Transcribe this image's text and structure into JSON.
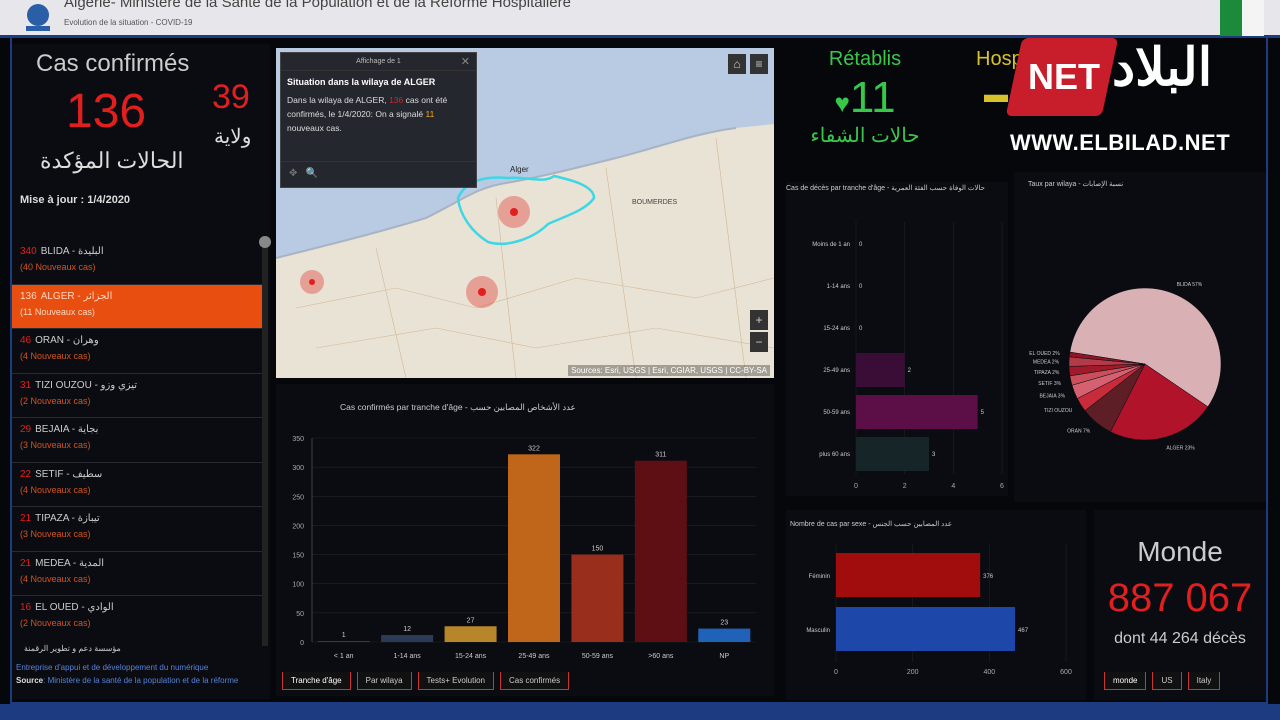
{
  "header": {
    "title": "Algérie- Ministère de la Santé de la Population et de la Réforme Hospitalière",
    "subtitle": "Evolution de la situation - COVID-19"
  },
  "left": {
    "cas_title": "Cas confirmés",
    "cas_value": "136",
    "cas_ar": "الحالات المؤكدة",
    "wilaya_value": "39",
    "wilaya_ar": "ولاية",
    "maj": "Mise à jour : 1/4/2020",
    "items": [
      {
        "n": "340",
        "name": "BLIDA - البليدة",
        "sub": "(40 Nouveaux cas)"
      },
      {
        "n": "136",
        "name": "ALGER - الجزائر",
        "sub": "(11 Nouveaux cas)"
      },
      {
        "n": "46",
        "name": "ORAN - وهران",
        "sub": "(4 Nouveaux cas)"
      },
      {
        "n": "31",
        "name": "TIZI OUZOU - تيزي وزو",
        "sub": "(2 Nouveaux cas)"
      },
      {
        "n": "29",
        "name": "BEJAIA - بجاية",
        "sub": "(3 Nouveaux cas)"
      },
      {
        "n": "22",
        "name": "SETIF - سطيف",
        "sub": "(4 Nouveaux cas)"
      },
      {
        "n": "21",
        "name": "TIPAZA - تيبازة",
        "sub": "(3 Nouveaux cas)"
      },
      {
        "n": "21",
        "name": "MEDEA - المدية",
        "sub": "(4 Nouveaux cas)"
      },
      {
        "n": "16",
        "name": "EL OUED - الوادي",
        "sub": "(2 Nouveaux cas)"
      }
    ],
    "footer_ar": "مؤسسة دعم و تطوير الرقمنة",
    "footer_org": "Entreprise d'appui et de développement du numérique",
    "footer_source_label": "Source",
    "footer_source": ": Ministère de la santé de la population et de la réforme"
  },
  "map": {
    "popup_header": "Affichage de 1",
    "popup_title": "Situation dans la wilaya de ALGER",
    "popup_text_a": "Dans la wilaya de ALGER,",
    "popup_red": "136",
    "popup_text_b": "cas ont été confirmés, le 1/4/2020: On a signalé",
    "popup_yellow": "11",
    "popup_text_c": "nouveaux cas.",
    "label_alger": "Alger",
    "label_boumerdes": "BOUMERDES",
    "attribution": "Sources: Esri, USGS | Esri, CGIAR, USGS | CC-BY-SA",
    "zoom_in": "+",
    "zoom_out": "−",
    "colors": {
      "sea": "#b9cbe2",
      "land": "#e9e3d5",
      "boundary": "#3fd6e6",
      "hotspot": "#e21f1f"
    }
  },
  "stats": {
    "retablis_label": "Rétablis",
    "retablis_value": "11",
    "retablis_ar": "حالات الشفاء",
    "hosp_label": "Hosp",
    "hosp_value": "..."
  },
  "watermark": {
    "net": "NET",
    "ar": "البلاد",
    "url": "WWW.ELBILAD.NET"
  },
  "monde": {
    "label": "Monde",
    "value": "887 067",
    "deaths": "dont 44 264 décès"
  },
  "tabs_bottom": [
    "Tranche d'âge",
    "Par wilaya",
    "Tests+ Evolution",
    "Cas confirmés"
  ],
  "tabs_monde": [
    "monde",
    "US",
    "Italy"
  ],
  "chart_data": [
    {
      "type": "bar",
      "title": "Cas confirmés par tranche d'âge - عدد الأشخاص المصابين حسب",
      "categories": [
        "< 1 an",
        "1-14 ans",
        "15-24 ans",
        "25-49 ans",
        "50-59 ans",
        ">60 ans",
        "NP"
      ],
      "values": [
        1,
        12,
        27,
        322,
        150,
        311,
        23
      ],
      "colors": [
        "#2b3a55",
        "#2b3a55",
        "#b7862a",
        "#c0661b",
        "#9a2e1d",
        "#5e0f13",
        "#1f62b8"
      ],
      "ylim": [
        0,
        350
      ],
      "yticks": [
        0,
        50,
        100,
        150,
        200,
        250,
        300,
        350
      ]
    },
    {
      "type": "bar",
      "orientation": "horizontal",
      "title": "Cas de décès par tranche d'âge - حالات الوفاة حسب الفئة العمرية",
      "categories": [
        "Moins de 1 an",
        "1-14 ans",
        "15-24 ans",
        "25-49 ans",
        "50-59 ans",
        "plus 60 ans"
      ],
      "values": [
        0,
        0,
        0,
        2,
        5,
        3
      ],
      "colors": [
        "#333",
        "#333",
        "#333",
        "#3a0d36",
        "#5c0f47",
        "#162628"
      ],
      "xlim": [
        0,
        6
      ],
      "xticks": [
        0,
        2,
        4,
        6
      ]
    },
    {
      "type": "pie",
      "title": "Taux par wilaya - نسبة الإصابات",
      "categories": [
        "BLIDA",
        "ALGER",
        "ORAN",
        "TIZI OUZOU",
        "BEJAIA",
        "SETIF",
        "TIPAZA",
        "MEDEA",
        "EL OUED"
      ],
      "values": [
        57,
        23,
        7,
        3,
        3,
        2,
        2,
        2,
        1
      ],
      "labels": [
        "BLIDA 57%",
        "ALGER 23%",
        "ORAN 7%",
        "TIZI OUZOU",
        "BEJAIA 3%",
        "SETIF 3%",
        "TIPAZA 2%",
        "MEDEA 2%",
        "EL OUED 2%"
      ],
      "colors": [
        "#d9b1b5",
        "#b1142a",
        "#5e1e25",
        "#c82b3a",
        "#d46070",
        "#c94f5b",
        "#a01a2b",
        "#b33a48",
        "#8d1524"
      ]
    },
    {
      "type": "bar",
      "orientation": "horizontal",
      "title": "Nombre de cas par sexe - عدد المصابين حسب الجنس",
      "categories": [
        "Féminin",
        "Masculin"
      ],
      "values": [
        376,
        467
      ],
      "colors": [
        "#a10d0d",
        "#1d47a8"
      ],
      "xlim": [
        0,
        600
      ],
      "xticks": [
        0,
        200,
        400,
        600
      ]
    }
  ]
}
